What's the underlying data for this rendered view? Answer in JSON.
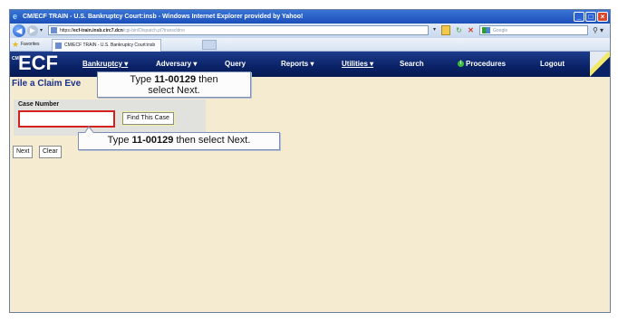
{
  "window": {
    "title": "CM/ECF TRAIN - U.S. Bankruptcy Court:insb - Windows Internet Explorer provided by Yahoo!"
  },
  "browser": {
    "url_proto": "https://",
    "url_host": "ecf-train.insb.circ7.dcn",
    "url_path": "/cgi-bin/Dispatch.pl?transcldno",
    "search_placeholder": "Google",
    "favorites_label": "Favorites",
    "tab_label": "CM/ECF TRAIN - U.S. Bankruptcy Court:insb"
  },
  "menu": {
    "logo_small": "CM",
    "logo": "ECF",
    "items": [
      {
        "label": "Bankruptcy ▾"
      },
      {
        "label": "Adversary ▾"
      },
      {
        "label": "Query"
      },
      {
        "label": "Reports ▾"
      },
      {
        "label": "Utilities ▾"
      },
      {
        "label": "Search"
      },
      {
        "label": "Procedures"
      },
      {
        "label": "Logout"
      }
    ]
  },
  "page": {
    "title": "File a Claim Eve",
    "case_number_label": "Case Number",
    "case_number_value": "",
    "find_button": "Find This Case",
    "next_button": "Next",
    "clear_button": "Clear"
  },
  "callouts": {
    "top_prefix": "Type ",
    "top_bold": "11-00129",
    "top_suffix": " then",
    "top_line2": "select Next.",
    "bottom_prefix": "Type ",
    "bottom_bold": "11-00129",
    "bottom_suffix": " then select Next."
  }
}
